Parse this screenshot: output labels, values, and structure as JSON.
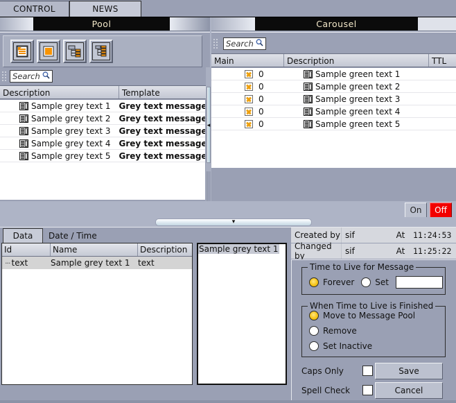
{
  "top_tabs": [
    {
      "label": "CONTROL",
      "active": false
    },
    {
      "label": "NEWS",
      "active": true
    }
  ],
  "pool_panel": {
    "title": "Pool",
    "toolbar": [
      {
        "icon": "message-document-icon"
      },
      {
        "icon": "page-template-icon"
      },
      {
        "icon": "tree-group-icon"
      },
      {
        "icon": "tree-list-icon"
      }
    ],
    "search": {
      "placeholder": "Search",
      "value": "",
      "icon": "search-icon"
    },
    "columns": [
      "Description",
      "Template"
    ],
    "rows": [
      {
        "description": "Sample grey text 1",
        "template": "Grey text message"
      },
      {
        "description": "Sample grey text 2",
        "template": "Grey text message"
      },
      {
        "description": "Sample grey text 3",
        "template": "Grey text message"
      },
      {
        "description": "Sample grey text 4",
        "template": "Grey text message"
      },
      {
        "description": "Sample grey text 5",
        "template": "Grey text message"
      }
    ]
  },
  "carousel_panel": {
    "title": "Carousel",
    "search": {
      "placeholder": "Search",
      "value": "",
      "icon": "search-icon"
    },
    "columns": [
      "Main",
      "Description",
      "TTL"
    ],
    "rows": [
      {
        "main_flag": "x-icon",
        "main": "0",
        "description": "Sample green text 1",
        "ttl": ""
      },
      {
        "main_flag": "x-icon",
        "main": "0",
        "description": "Sample green text 2",
        "ttl": ""
      },
      {
        "main_flag": "x-icon",
        "main": "0",
        "description": "Sample green text 3",
        "ttl": ""
      },
      {
        "main_flag": "x-icon",
        "main": "0",
        "description": "Sample green text 4",
        "ttl": ""
      },
      {
        "main_flag": "x-icon",
        "main": "0",
        "description": "Sample green text 5",
        "ttl": ""
      }
    ]
  },
  "power": {
    "on_label": "On",
    "off_label": "Off",
    "off_color": "#f20000",
    "active": "Off"
  },
  "splitter": {
    "vertical_chevron": "◂",
    "horizontal_chevron": "▾"
  },
  "bottom": {
    "tabs": [
      {
        "label": "Data",
        "active": true
      },
      {
        "label": "Date / Time",
        "active": false
      }
    ],
    "data_table": {
      "columns": [
        "Id",
        "Name",
        "Description"
      ],
      "rows": [
        {
          "id": "text",
          "name": "Sample grey text 1",
          "description": "text",
          "tree_prefix": "···"
        }
      ]
    },
    "preview": {
      "text": "Sample grey text 1"
    },
    "info": {
      "created_by_label": "Created by",
      "created_by_value": "sif",
      "created_at_label": "At",
      "created_at_value": "11:24:53",
      "changed_by_label": "Changed by",
      "changed_by_value": "sif",
      "changed_at_label": "At",
      "changed_at_value": "11:25:22"
    },
    "ttl_group": {
      "legend": "Time to Live for Message",
      "forever_label": "Forever",
      "set_label": "Set",
      "selected": "Forever",
      "set_value": ""
    },
    "finished_group": {
      "legend": "When Time to Live is Finished",
      "options": [
        "Move to Message Pool",
        "Remove",
        "Set Inactive"
      ],
      "selected": "Move to Message Pool"
    },
    "checkboxes": [
      {
        "label": "Caps Only",
        "checked": false
      },
      {
        "label": "Spell Check",
        "checked": false
      }
    ],
    "buttons": {
      "save": "Save",
      "cancel": "Cancel"
    }
  }
}
